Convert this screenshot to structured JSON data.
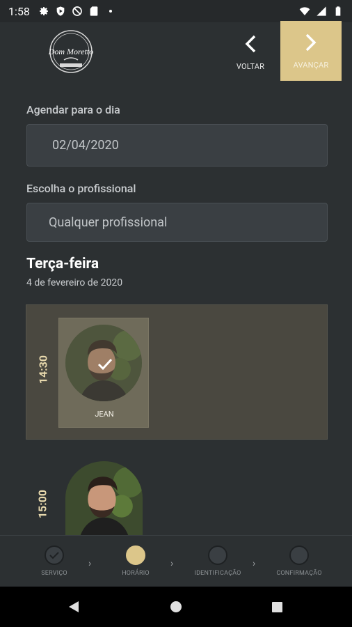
{
  "status_bar": {
    "time": "1:58"
  },
  "header": {
    "logo_text": "Dom Moretto",
    "back_label": "VOLTAR",
    "forward_label": "AVANÇAR",
    "accent_color": "#dcc68a"
  },
  "form": {
    "date_label": "Agendar para o dia",
    "date_value": "02/04/2020",
    "professional_label": "Escolha o profissional",
    "professional_value": "Qualquer profissional"
  },
  "day": {
    "title": "Terça-feira",
    "subtitle": "4 de fevereiro de 2020"
  },
  "slots": [
    {
      "time": "14:30",
      "professional": "JEAN",
      "selected": true
    },
    {
      "time": "15:00"
    }
  ],
  "steps": [
    {
      "label": "SERVIÇO",
      "state": "done"
    },
    {
      "label": "HORÁRIO",
      "state": "active"
    },
    {
      "label": "IDENTIFICAÇÃO",
      "state": "pending"
    },
    {
      "label": "CONFIRMAÇÃO",
      "state": "pending"
    }
  ]
}
